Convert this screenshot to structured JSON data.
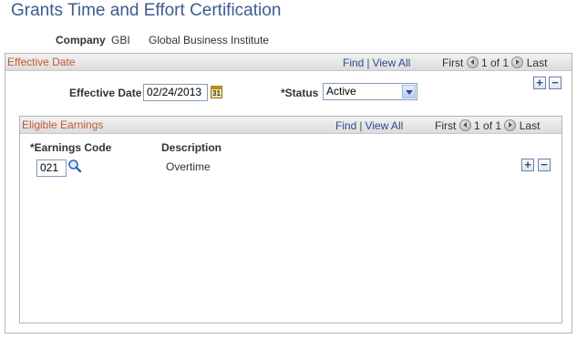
{
  "page": {
    "title": "Grants Time and Effort Certification"
  },
  "company": {
    "label": "Company",
    "code": "GBI",
    "name": "Global Business Institute"
  },
  "effective_date_grid": {
    "title": "Effective Date",
    "find": "Find",
    "separator": "|",
    "view_all": "View All",
    "first": "First",
    "range": "1 of 1",
    "last": "Last",
    "effective_date_label": "Effective Date",
    "effective_date_value": "02/24/2013",
    "calendar_glyph": "31",
    "status_label": "*Status",
    "status_value": "Active",
    "add_label": "+",
    "delete_label": "−"
  },
  "eligible_earnings_grid": {
    "title": "Eligible Earnings",
    "find": "Find",
    "separator": "|",
    "view_all": "View All",
    "first": "First",
    "range": "1 of 1",
    "last": "Last",
    "columns": [
      "*Earnings Code",
      "Description"
    ],
    "rows": [
      {
        "earnings_code": "021",
        "description": "Overtime"
      }
    ],
    "add_label": "+",
    "delete_label": "−"
  },
  "colors": {
    "page_title": "#3c5c8f",
    "grid_title": "#c25a34",
    "link": "#2a4e8c"
  },
  "icons": [
    "calendar-icon",
    "chevron-down-icon",
    "search-icon",
    "previous-icon",
    "next-icon",
    "add-row-icon",
    "delete-row-icon"
  ]
}
